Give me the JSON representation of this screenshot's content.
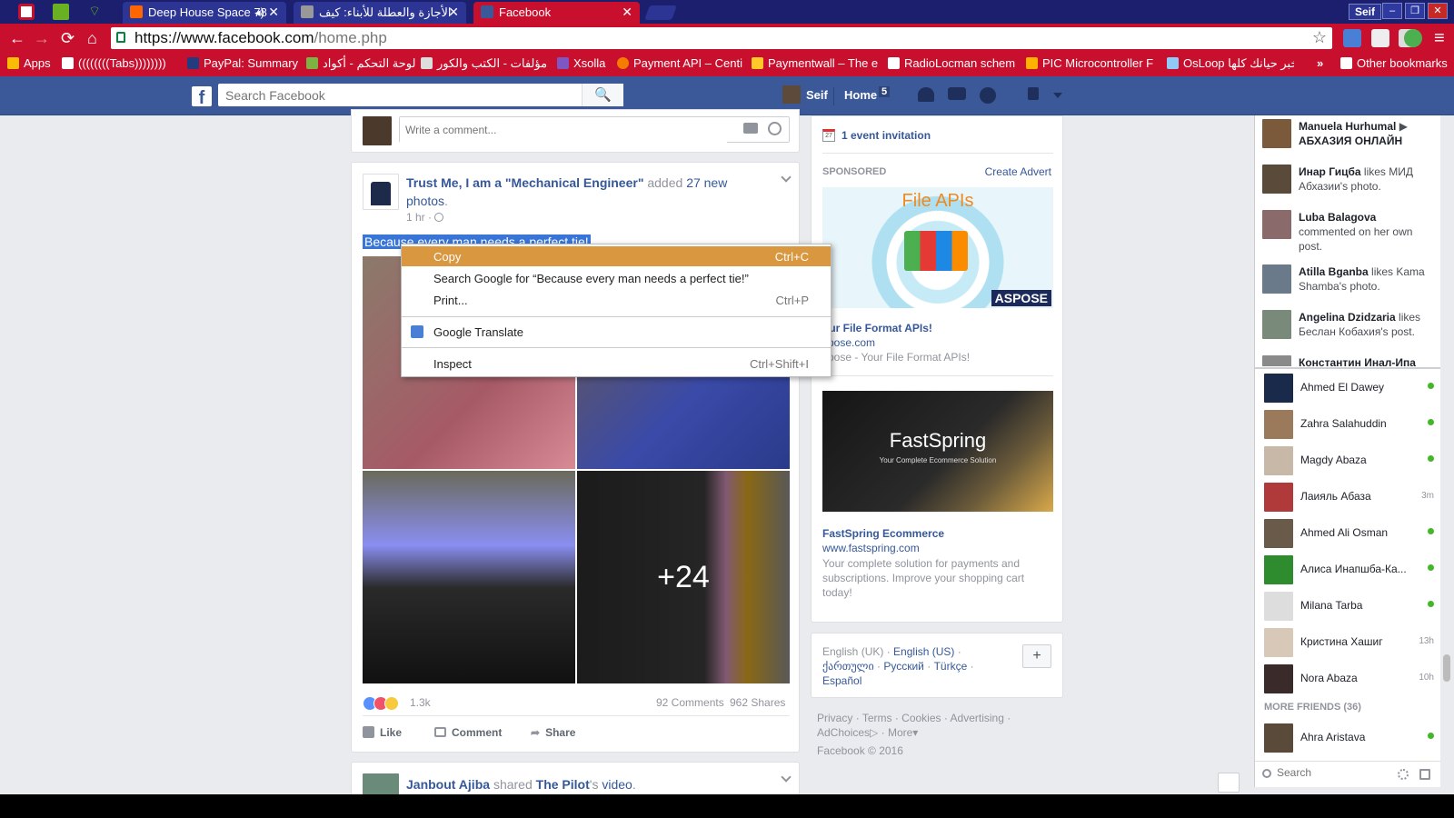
{
  "tabs": [
    {
      "title": "Deep House Space 78",
      "favicon_color": "#f60",
      "active": false
    },
    {
      "title": "الأجازة والعطلة للأبناء: كيف",
      "favicon_color": "#999",
      "active": false
    },
    {
      "title": "Facebook",
      "favicon_color": "#3b5998",
      "active": true
    }
  ],
  "window": {
    "user": "Seif",
    "minimize": "–",
    "maximize": "❐",
    "close": "✕"
  },
  "toolbar": {
    "url_scheme_host": "https://www.facebook.com",
    "url_path": "/home.php",
    "back": "←",
    "forward": "→",
    "reload": "⟳",
    "home": "⌂",
    "star": "☆",
    "menu": "≡"
  },
  "bookmarks": [
    {
      "label": "Apps"
    },
    {
      "label": "((((((((Tabs))))))))"
    },
    {
      "label": "PayPal: Summary"
    },
    {
      "label": "لوحة التحكم - أكواد"
    },
    {
      "label": "مؤلفات - الكتب والكور"
    },
    {
      "label": "Xsolla"
    },
    {
      "label": "Payment API – Centi"
    },
    {
      "label": "Paymentwall – The e"
    },
    {
      "label": "RadioLocman schem"
    },
    {
      "label": "PIC Microcontroller F"
    },
    {
      "label": "OsLoop"
    },
    {
      "label": "خبر حيانك كلها"
    },
    {
      "label": "»"
    },
    {
      "label": "Other bookmarks"
    }
  ],
  "fbheader": {
    "logo": "f",
    "search_placeholder": "Search Facebook",
    "search_icon": "🔍",
    "user_name": "Seif",
    "home_label": "Home",
    "home_count": "5"
  },
  "comment_box": {
    "placeholder": "Write a comment..."
  },
  "post": {
    "page_name": "Trust Me, I am a \"Mechanical Engineer\"",
    "action": "added",
    "photos_link": "27 new photos",
    "period": ".",
    "time": "1 hr",
    "sep": "·",
    "text": "Because every man needs a perfect tie!",
    "more_photos": "+24",
    "reactions_count": "1.3k",
    "comments": "92 Comments",
    "shares": "962 Shares",
    "like": "Like",
    "comment": "Comment",
    "share": "Share"
  },
  "next_post": {
    "author": "Janbout Ajiba",
    "action": "shared",
    "target": "The Pilot",
    "suffix": "'s",
    "object": "video",
    "period": "."
  },
  "context_menu": {
    "copy": "Copy",
    "copy_sc": "Ctrl+C",
    "search": "Search Google for “Because every man needs a perfect tie!”",
    "print": "Print...",
    "print_sc": "Ctrl+P",
    "translate": "Google Translate",
    "inspect": "Inspect",
    "inspect_sc": "Ctrl+Shift+I"
  },
  "rightcol": {
    "calendar_day": "27",
    "event": "1 event invitation",
    "sponsored": "SPONSORED",
    "create_advert": "Create Advert",
    "ad1_banner": "File APIs",
    "ad1_brand": "ASPOSE",
    "ad1_title": "our File Format APIs!",
    "ad1_site": "spose.com",
    "ad1_desc": "spose - Your File Format APIs!",
    "ad2_brand": "FastSpring",
    "ad2_sub": "Your Complete Ecommerce Solution",
    "ad2_title": "FastSpring Ecommerce",
    "ad2_site": "www.fastspring.com",
    "ad2_desc": "Your complete solution for payments and subscriptions. Improve your shopping cart today!",
    "lang_current": "English (UK)",
    "dot": "·",
    "lang_us": "English (US)",
    "lang_ka": "ქართული",
    "lang_ru": "Русский",
    "lang_tr": "Türkçe",
    "lang_es": "Español",
    "add_lang": "+",
    "footer_privacy": "Privacy",
    "footer_terms": "Terms",
    "footer_cookies": "Cookies",
    "footer_advertising": "Advertising",
    "footer_adchoices": "AdChoices",
    "adchoices_icon": "▷",
    "footer_more": "More",
    "more_caret": "▾",
    "copyright": "Facebook © 2016"
  },
  "ticker": [
    {
      "name": "Manuela Hurhumal",
      "arrow": "▶",
      "rest": "АБХАЗИЯ ОНЛАЙН",
      "rest_bold": true
    },
    {
      "name": "Инар Гицба",
      "arrow": "",
      "rest": "likes МИД Абхазии's photo.",
      "rest_bold": false
    },
    {
      "name": "Luba Balagova",
      "arrow": "",
      "rest": "commented on her own post.",
      "rest_bold": false
    },
    {
      "name": "Atilla Bganba",
      "arrow": "",
      "rest": "likes Kama Shamba's photo.",
      "rest_bold": false
    },
    {
      "name": "Angelina Dzidzaria",
      "arrow": "",
      "rest": "likes Беслан Кобахия's post.",
      "rest_bold": false
    },
    {
      "name": "Константин Инал-Ипа",
      "arrow": "",
      "rest": "",
      "rest_bold": false
    }
  ],
  "friends": [
    {
      "name": "Ahmed El Dawey",
      "status": ""
    },
    {
      "name": "Zahra Salahuddin",
      "status": ""
    },
    {
      "name": "Magdy Abaza",
      "status": ""
    },
    {
      "name": "Лаияль Абаза",
      "status": "3m"
    },
    {
      "name": "Ahmed Ali Osman",
      "status": ""
    },
    {
      "name": "Алиса Инапшба-Ка...",
      "status": ""
    },
    {
      "name": "Milana Tarba",
      "status": ""
    },
    {
      "name": "Кристина Хашиг",
      "status": "13h"
    },
    {
      "name": "Nora Abaza",
      "status": "10h"
    }
  ],
  "more_friends": "MORE FRIENDS (36)",
  "more_friend": {
    "name": "Ahra Aristava"
  },
  "chat_search_placeholder": "Search"
}
